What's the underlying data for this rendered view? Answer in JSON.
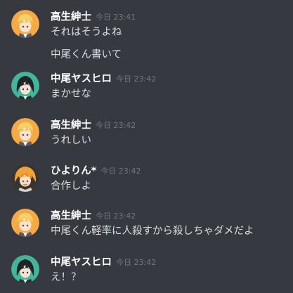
{
  "messages": [
    {
      "author": "高生紳士",
      "timestamp": "今日 23:41",
      "avatar": "blond-character-avatar",
      "lines": [
        "それはそうよね",
        "中尾くん書いて"
      ]
    },
    {
      "author": "中尾ヤスヒロ",
      "timestamp": "今日 23:42",
      "avatar": "dark-haired-character-avatar",
      "lines": [
        "まかせな"
      ]
    },
    {
      "author": "高生紳士",
      "timestamp": "今日 23:42",
      "avatar": "blond-character-avatar",
      "lines": [
        "うれしい"
      ]
    },
    {
      "author": "ひよりん*",
      "timestamp": "今日 23:42",
      "avatar": "orange-haired-character-avatar",
      "lines": [
        "合作しよ"
      ]
    },
    {
      "author": "高生紳士",
      "timestamp": "今日 23:42",
      "avatar": "blond-character-avatar",
      "lines": [
        "中尾くん軽率に人殺すから殺しちゃダメだよ"
      ]
    },
    {
      "author": "中尾ヤスヒロ",
      "timestamp": "今日 23:42",
      "avatar": "dark-haired-character-avatar",
      "lines": [
        "え！？"
      ]
    }
  ],
  "colors": {
    "background": "#36393f",
    "author_name": "#ffffff",
    "message_text": "#dcddde",
    "timestamp": "#72767d",
    "avatar_orange": "#f6a945",
    "avatar_teal": "#43b59a"
  }
}
